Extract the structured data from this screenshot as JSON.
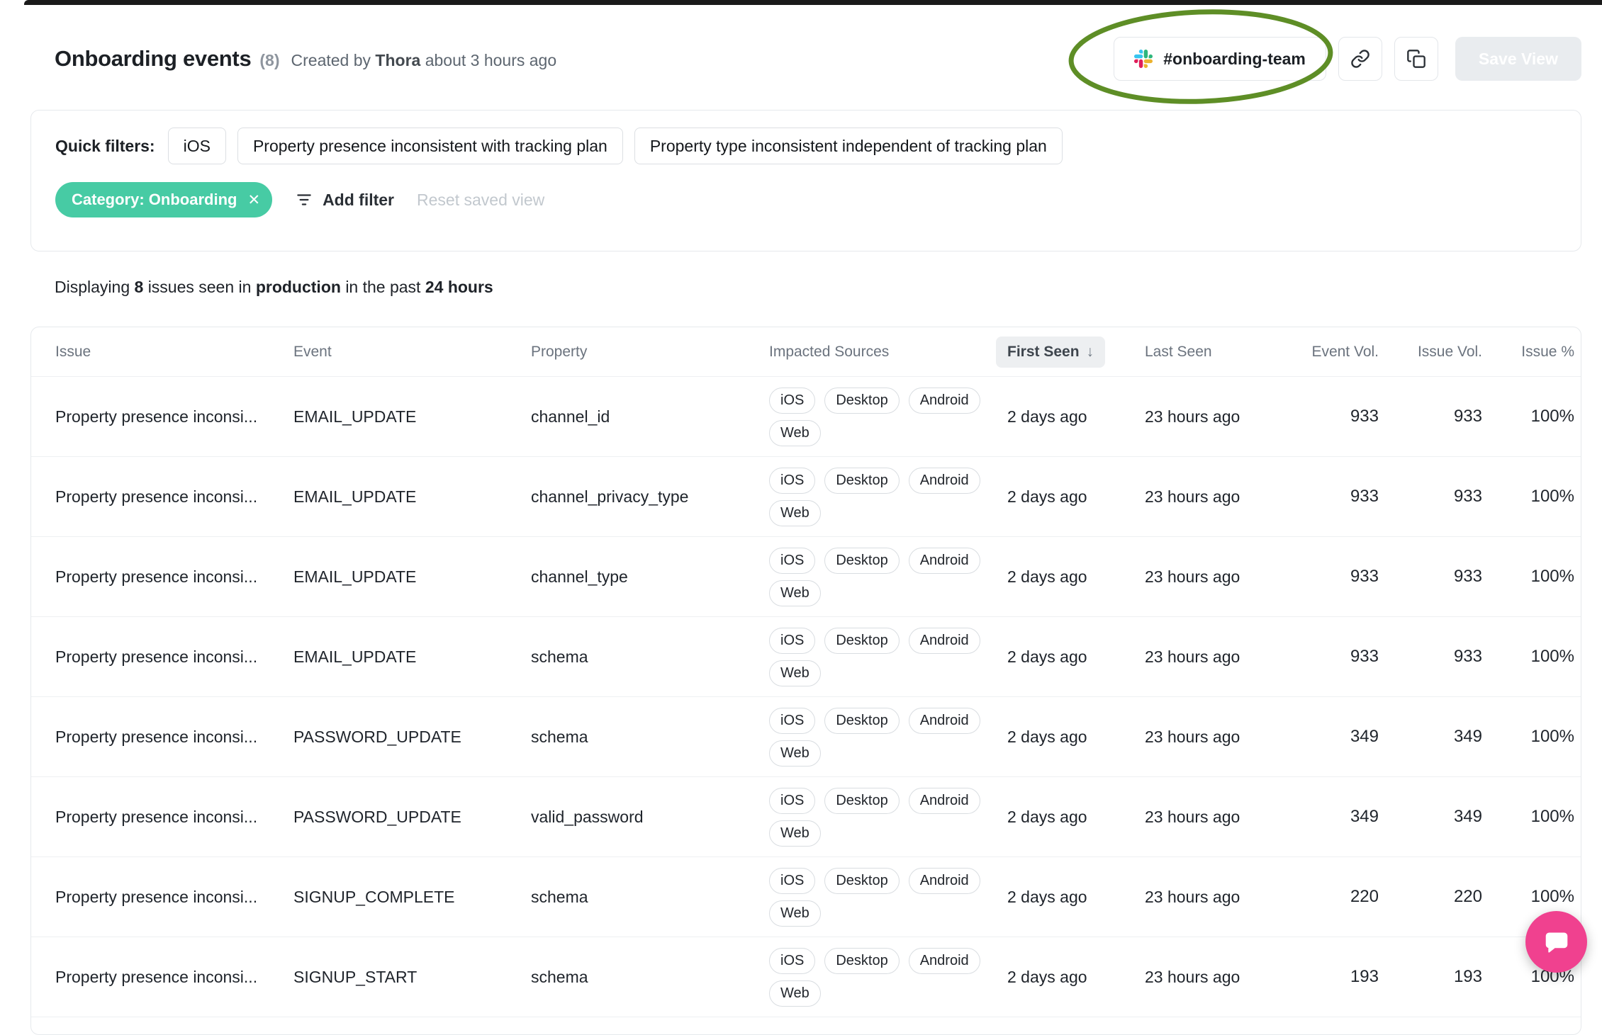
{
  "colors": {
    "accent_teal": "#47CBA4",
    "annotation_green": "#5E8E26",
    "intercom_pink": "#F0418F",
    "slack_logo": [
      "#36C5F0",
      "#2EB67D",
      "#ECB22E",
      "#E01E5A"
    ],
    "save_button_bg": "#E9ECEF"
  },
  "header": {
    "title": "Onboarding events",
    "count": "(8)",
    "created_prefix": "Created by",
    "author": "Thora",
    "created_suffix": "about 3 hours ago",
    "slack_channel": "#onboarding-team",
    "save_view_label": "Save View"
  },
  "filters": {
    "label": "Quick filters:",
    "quick": [
      "iOS",
      "Property presence inconsistent with tracking plan",
      "Property type inconsistent independent of tracking plan"
    ],
    "active_chip": "Category: Onboarding",
    "remove_icon": "✕",
    "add_filter_label": "Add filter",
    "reset_label": "Reset saved view"
  },
  "summary": {
    "p1": "Displaying",
    "count": "8",
    "p2": "issues seen in",
    "env": "production",
    "p3": "in the past",
    "range": "24 hours"
  },
  "table": {
    "columns": [
      "Issue",
      "Event",
      "Property",
      "Impacted Sources",
      "First Seen",
      "Last Seen",
      "Event Vol.",
      "Issue Vol.",
      "Issue %"
    ],
    "sort_icon": "↓",
    "rows": [
      {
        "issue": "Property presence inconsi...",
        "event": "EMAIL_UPDATE",
        "property": "channel_id",
        "sources": [
          "iOS",
          "Desktop",
          "Android",
          "Web"
        ],
        "first_seen": "2 days ago",
        "last_seen": "23 hours ago",
        "event_vol": "933",
        "issue_vol": "933",
        "issue_pct": "100%"
      },
      {
        "issue": "Property presence inconsi...",
        "event": "EMAIL_UPDATE",
        "property": "channel_privacy_type",
        "sources": [
          "iOS",
          "Desktop",
          "Android",
          "Web"
        ],
        "first_seen": "2 days ago",
        "last_seen": "23 hours ago",
        "event_vol": "933",
        "issue_vol": "933",
        "issue_pct": "100%"
      },
      {
        "issue": "Property presence inconsi...",
        "event": "EMAIL_UPDATE",
        "property": "channel_type",
        "sources": [
          "iOS",
          "Desktop",
          "Android",
          "Web"
        ],
        "first_seen": "2 days ago",
        "last_seen": "23 hours ago",
        "event_vol": "933",
        "issue_vol": "933",
        "issue_pct": "100%"
      },
      {
        "issue": "Property presence inconsi...",
        "event": "EMAIL_UPDATE",
        "property": "schema",
        "sources": [
          "iOS",
          "Desktop",
          "Android",
          "Web"
        ],
        "first_seen": "2 days ago",
        "last_seen": "23 hours ago",
        "event_vol": "933",
        "issue_vol": "933",
        "issue_pct": "100%"
      },
      {
        "issue": "Property presence inconsi...",
        "event": "PASSWORD_UPDATE",
        "property": "schema",
        "sources": [
          "iOS",
          "Desktop",
          "Android",
          "Web"
        ],
        "first_seen": "2 days ago",
        "last_seen": "23 hours ago",
        "event_vol": "349",
        "issue_vol": "349",
        "issue_pct": "100%"
      },
      {
        "issue": "Property presence inconsi...",
        "event": "PASSWORD_UPDATE",
        "property": "valid_password",
        "sources": [
          "iOS",
          "Desktop",
          "Android",
          "Web"
        ],
        "first_seen": "2 days ago",
        "last_seen": "23 hours ago",
        "event_vol": "349",
        "issue_vol": "349",
        "issue_pct": "100%"
      },
      {
        "issue": "Property presence inconsi...",
        "event": "SIGNUP_COMPLETE",
        "property": "schema",
        "sources": [
          "iOS",
          "Desktop",
          "Android",
          "Web"
        ],
        "first_seen": "2 days ago",
        "last_seen": "23 hours ago",
        "event_vol": "220",
        "issue_vol": "220",
        "issue_pct": "100%"
      },
      {
        "issue": "Property presence inconsi...",
        "event": "SIGNUP_START",
        "property": "schema",
        "sources": [
          "iOS",
          "Desktop",
          "Android",
          "Web"
        ],
        "first_seen": "2 days ago",
        "last_seen": "23 hours ago",
        "event_vol": "193",
        "issue_vol": "193",
        "issue_pct": "100%"
      }
    ]
  }
}
